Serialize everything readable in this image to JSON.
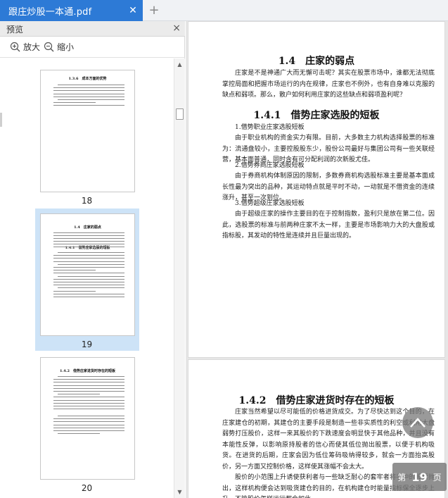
{
  "tab": {
    "title": "跟庄炒股一本通.pdf",
    "close_icon": "close-icon"
  },
  "new_tab_label": "+",
  "sidebar": {
    "title": "预览",
    "close_label": "×",
    "zoom_in": "放大",
    "zoom_out": "缩小",
    "thumbnails": [
      {
        "page": "18",
        "heading": "1.3.6　成本方面的优势"
      },
      {
        "page": "19",
        "heading": "1.4　庄家的弱点",
        "subheading": "1.4.1　借势庄家选股的短板",
        "selected": true
      },
      {
        "page": "20",
        "heading": "1.4.2　借势庄家进货时存在的短板"
      }
    ]
  },
  "document": {
    "page1": {
      "section_title": "1.4　庄家的弱点",
      "intro": "庄家是不是神通广大而无懈可击呢？其实在股票市场中，谁都无法彻底掌控局面和把握市场运行的内在规律，庄家也不例外，也有自身难以克服的缺点和弱项。那么，散户如何利用庄家的这些缺点和弱项盈利呢？",
      "subsection_title": "1.4.1　借势庄家选股的短板",
      "item1_title": "1.借势职业庄家选股短板",
      "item1_body": "由于职业机构的资金实力有限。目前，大多数主力机构选择股票的标准为：流通盘较小，主要控股股东少，股份公司最好与集团公司有一些关联经营，基本面普通，同时含有可分配利润的次新股尤佳。",
      "item2_title": "2.借势券商庄家选股短板",
      "item2_body": "由于券商机构体制原因的限制，多数券商机构选股标准主要是基本面成长性最为突出的品种，其运动特点就是平时不动，一动就是不借资金的连续涨升，甚至一次到位。",
      "item3_title": "3.借势超级庄家选股短板",
      "item3_body": "由于超级庄家的操作主要目的在于控制指数，盈利只是放在第二位。因此，选股票的标准与前两种庄家不太一样，主要是市场影响力大的大盘股或指标股，其发动的特性是连续并且巨量出现的。"
    },
    "page2": {
      "section_title": "1.4.2　借势庄家进货时存在的短板",
      "para1": "庄家当然希望以尽可能低的价格进货成交。为了尽快达到这个目的，在庄家建仓的初期，其建仓的主要手段是制造一些非实质性的利空或利用大盘弱势打压股价，这样一来其股价的下跌速度会明显快于其他品种，并且没有本能性反弹，以影响原持股者的信心而使其低位抛出股票，以便于机构吸货。在进货的后期，庄家会因为低位筹码吸纳得较多，就会一方面抬高股价，另一方面又控制价格，这样使其涨幅不会太大。",
      "para2": "股价的小范围上升诱使获利者与一些缺乏耐心的套牢者将手中的股票抛出，这样机构便会达到吸货建仓的目的，在机构建仓时能量指标保全逐步上升，不管股价怎样运行都会如此。"
    }
  },
  "page_indicator": {
    "prefix": "第",
    "number": "19",
    "suffix": "页"
  }
}
